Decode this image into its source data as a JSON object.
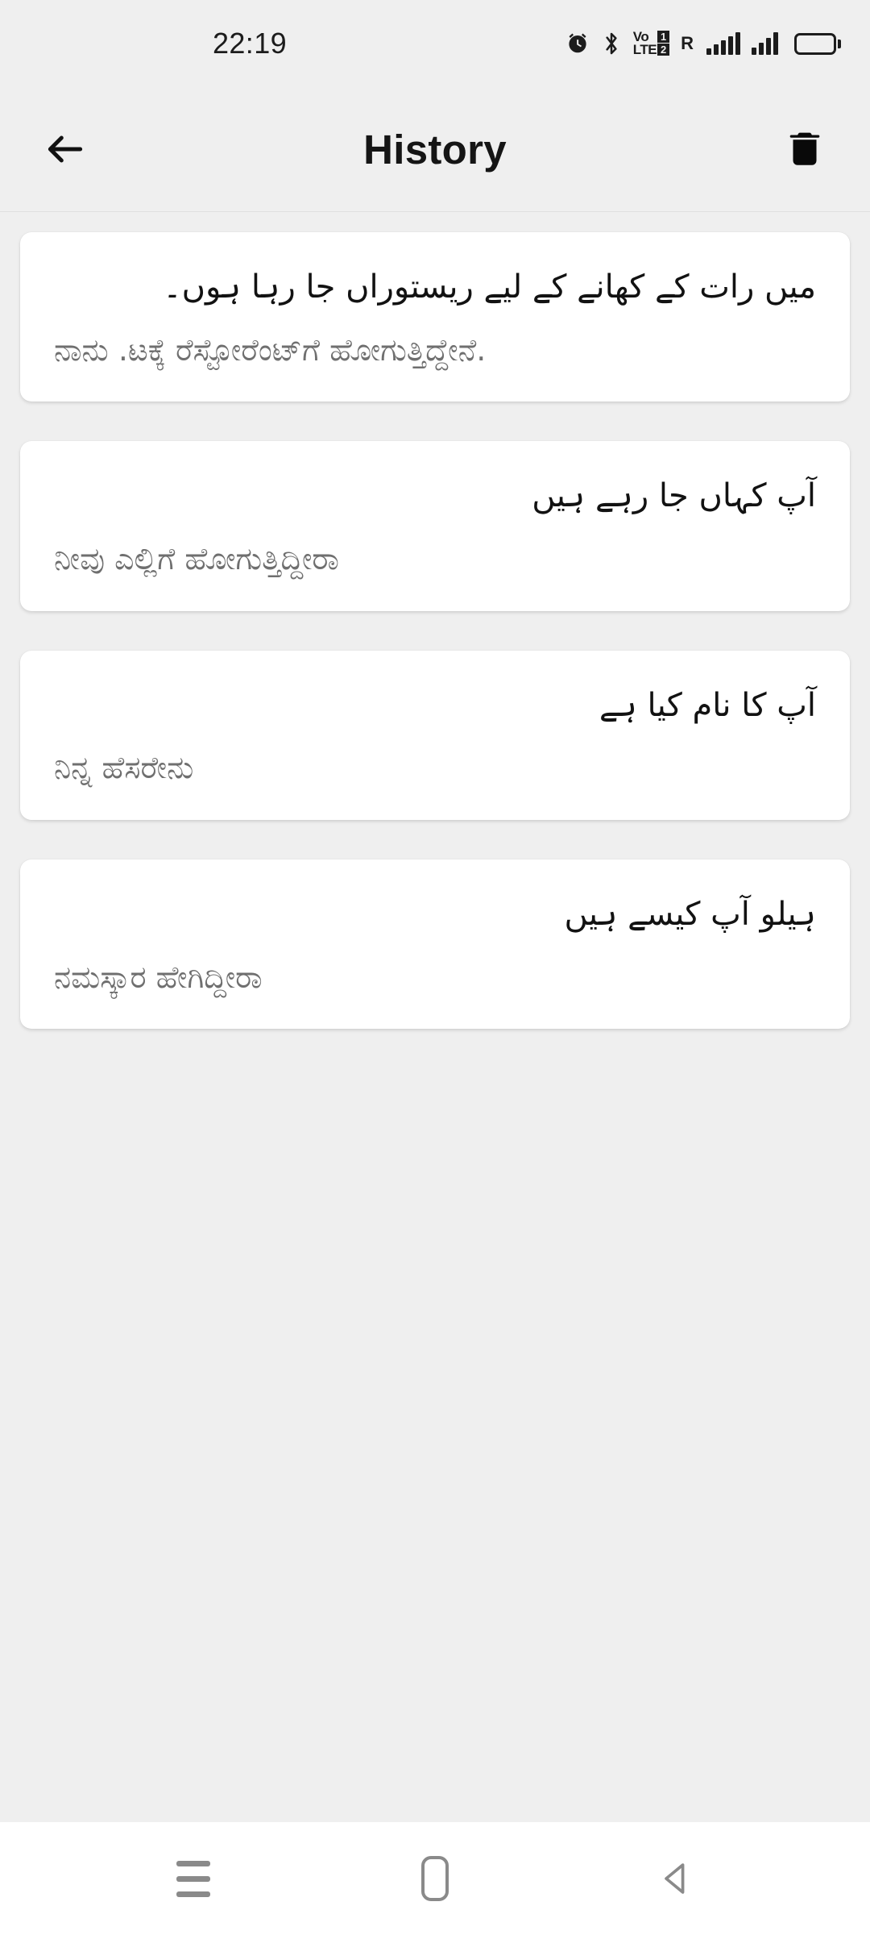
{
  "status_bar": {
    "time": "22:19",
    "icons": [
      {
        "name": "alarm-icon",
        "label": "alarm"
      },
      {
        "name": "bluetooth-icon",
        "label": "bluetooth"
      },
      {
        "name": "volte-icon",
        "label": "VoLTE"
      },
      {
        "name": "roaming-icon",
        "label": "R"
      },
      {
        "name": "signal-sim1-icon",
        "label": "signal 5/5"
      },
      {
        "name": "signal-sim2-icon",
        "label": "signal 4/4"
      },
      {
        "name": "battery-icon",
        "label": "battery full"
      }
    ],
    "volte": {
      "line1": "Vo",
      "line2": "LTE",
      "sim1": "1",
      "sim2": "2"
    },
    "roaming_label": "R"
  },
  "app_bar": {
    "title": "History",
    "back_label": "Back",
    "delete_label": "Clear history"
  },
  "history": {
    "items": [
      {
        "source_text": "میں رات کے کھانے کے لیے ریستوراں جا رہا ہوں۔",
        "translated_text": "ನಾನು .ಟಕ್ಕೆ ರೆಸ್ಟೋರೆಂಟ್‌ಗೆ ಹೋಗುತ್ತಿದ್ದೇನೆ."
      },
      {
        "source_text": "آپ کہاں جا رہے ہیں",
        "translated_text": "ನೀವು ಎಲ್ಲಿಗೆ ಹೋಗುತ್ತಿದ್ದೀರಾ"
      },
      {
        "source_text": "آپ کا نام کیا ہے",
        "translated_text": "ನಿನ್ನ ಹೆಸರೇನು"
      },
      {
        "source_text": "ہیلو آپ کیسے ہیں",
        "translated_text": "ನಮಸ್ಕಾರ ಹೇಗಿದ್ದೀರಾ"
      }
    ]
  },
  "nav_bar": {
    "recents_label": "Recents",
    "home_label": "Home",
    "back_label": "Back"
  },
  "colors": {
    "background": "#efefef",
    "card": "#ffffff",
    "primary_text": "#121212",
    "secondary_text": "#6f6f6f",
    "nav_icon": "#8a8a8a"
  }
}
